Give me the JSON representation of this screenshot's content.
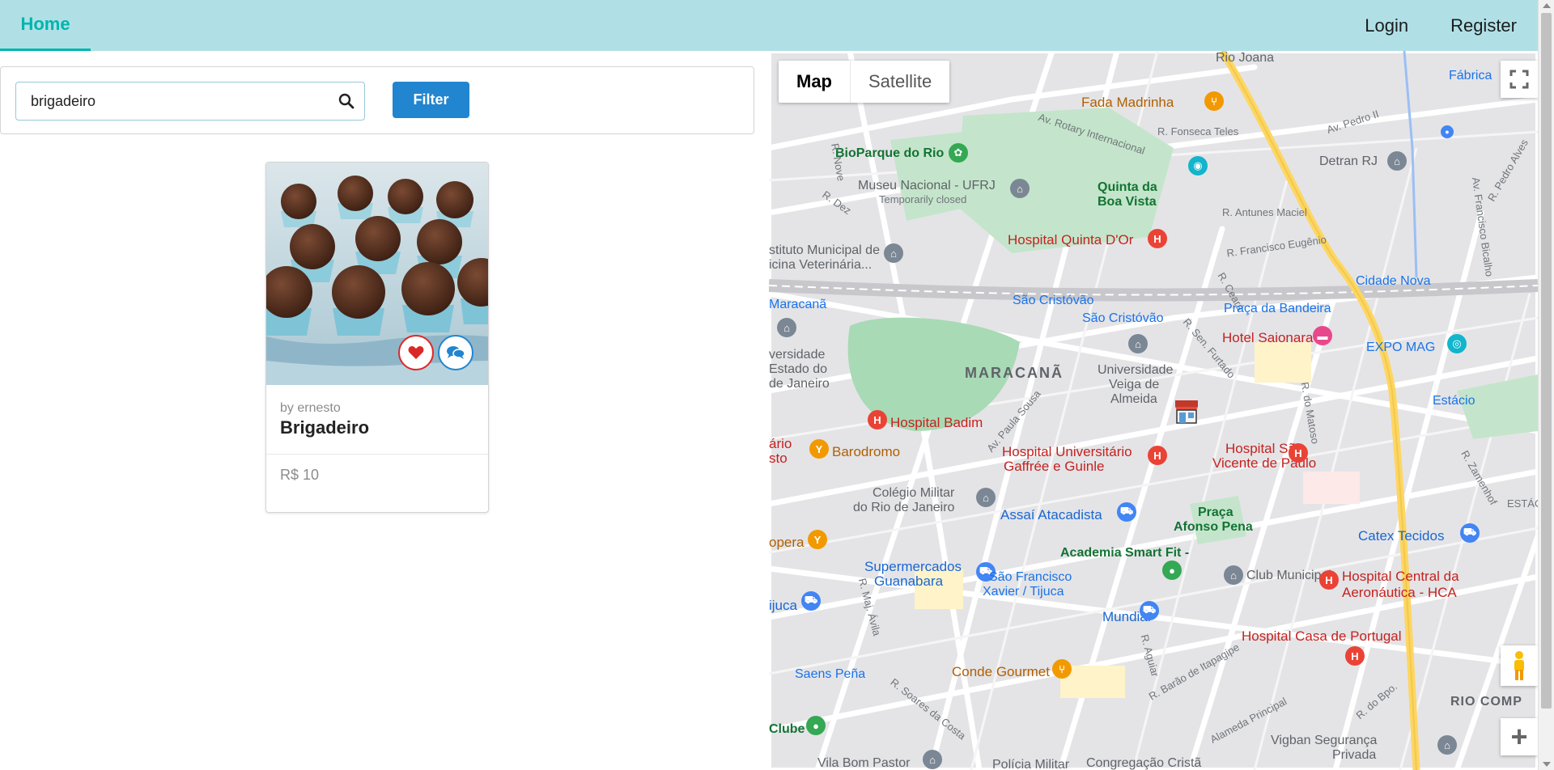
{
  "navbar": {
    "home": "Home",
    "login": "Login",
    "register": "Register"
  },
  "search": {
    "value": "brigadeiro",
    "icon": "search-icon",
    "filter_label": "Filter"
  },
  "products": [
    {
      "author": "by ernesto",
      "title": "Brigadeiro",
      "price": "R$ 10",
      "like_icon": "heart-icon",
      "chat_icon": "comments-icon"
    }
  ],
  "map": {
    "type_map": "Map",
    "type_satellite": "Satellite",
    "labels": {
      "rio_joana": "Rio Joana",
      "fabrica": "Fábrica",
      "fada_madrinha": "Fada Madrinha",
      "av_rotary": "Av. Rotary Internacional",
      "r_fonseca_teles": "R. Fonseca Teles",
      "av_pedro_ii": "Av. Pedro II",
      "detran": "Detran RJ",
      "bioparque": "BioParque do Rio",
      "museu": "Museu Nacional - UFRJ",
      "temp_closed": "Temporarily closed",
      "quinta": "Quinta da",
      "boa_vista": "Boa Vista",
      "r_nove": "R. Nove",
      "r_dez": "R. Dez",
      "r_antunes": "R. Antunes Maciel",
      "r_francisco_eugenio": "R. Francisco Eugênio",
      "av_francisco_bicalho": "Av. Francisco Bicalho",
      "r_pedro_alves": "R. Pedro Alves",
      "hospital_quinta": "Hospital Quinta D'Or",
      "instituto": "stituto Municipal de",
      "veterinaria": "icina Veterinária...",
      "cidade_nova": "Cidade Nova",
      "maracana_station": "Maracanã",
      "sao_cristovao_1": "São Cristóvão",
      "sao_cristovao_2": "São Cristóvão",
      "r_ceara": "R. Ceará",
      "praca_bandeira": "Praça da Bandeira",
      "hotel_saionara": "Hotel Saionara",
      "expo_mag": "EXPO MAG",
      "universidade_1": "versidade",
      "universidade_2": "Estado do",
      "universidade_3": "de Janeiro",
      "maracana_district": "MARACANÃ",
      "veiga_1": "Universidade",
      "veiga_2": "Veiga de",
      "veiga_3": "Almeida",
      "r_sen_furtado": "R. Sen. Furtado",
      "r_do_matoso": "R. do Matoso",
      "estacio": "Estácio",
      "av_paula_sousa": "Av. Paula Sousa",
      "hospital_badim": "Hospital Badim",
      "hospital_ufrj_1": "Hospital Universitário",
      "hospital_ufrj_2": "Gaffrée e Guinle",
      "hospital_sao_1": "Hospital São",
      "hospital_sao_2": "Vicente de Paulo",
      "r_zamenhof": "R. Zamenhof",
      "dario_1": "ário",
      "dario_2": "sto",
      "barodromo": "Barodromo",
      "colegio_1": "Colégio Militar",
      "colegio_2": "do Rio de Janeiro",
      "assai": "Assaí Atacadista",
      "praca_afonso_1": "Praça",
      "praca_afonso_2": "Afonso Pena",
      "estac": "ESTÁC",
      "catex": "Catex Tecidos",
      "opera": "opera",
      "academia": "Academia Smart Fit -",
      "supermercados_1": "Supermercados",
      "supermercados_2": "Guanabara",
      "sao_francisco_1": "São Francisco",
      "sao_francisco_2": "Xavier / Tijuca",
      "club_municipal": "Club Municipal",
      "hospital_central_1": "Hospital Central da",
      "hospital_central_2": "Aeronáutica - HCA",
      "r_maj_avila": "R. Maj. Ávila",
      "tijuca": "ijuca",
      "mundial": "Mundial",
      "hospital_portugal": "Hospital Casa de Portugal",
      "r_aguiar": "R. Aguiar",
      "r_barao": "R. Barão de Itapagipe",
      "saens_pena": "Saens Peña",
      "conde_gourmet": "Conde Gourmet",
      "r_soares": "R. Soares da Costa",
      "r_do_bpo": "R. do Bpo.",
      "rio_comp": "RIO COMP",
      "clube": "Clube",
      "alameda": "Alameda Principal",
      "vigban_1": "Vigban Segurança",
      "vigban_2": "Privada",
      "vila_bom": "Vila Bom Pastor",
      "policia": "Polícia Militar",
      "congregacao": "Congregação Cristã"
    }
  },
  "colors": {
    "navbar_bg": "#b0e0e6",
    "home_accent": "#00b5ad",
    "filter_button": "#2185d0",
    "like": "#db2828",
    "chat": "#2185d0",
    "park": "#a8dab5",
    "road_major": "#fdd663"
  }
}
